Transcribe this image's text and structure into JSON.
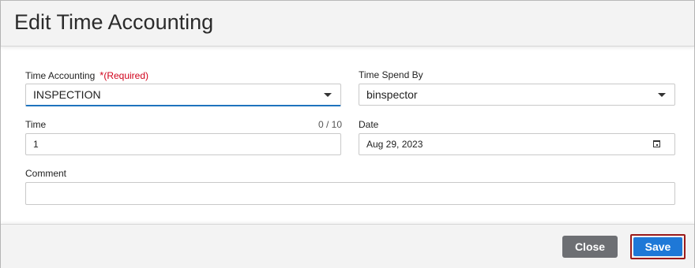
{
  "dialog": {
    "title": "Edit Time Accounting"
  },
  "form": {
    "time_accounting": {
      "label": "Time Accounting",
      "required_star": "*",
      "required_text": "(Required)",
      "value": "INSPECTION"
    },
    "time_spend_by": {
      "label": "Time Spend By",
      "value": "binspector"
    },
    "time": {
      "label": "Time",
      "counter": "0 / 10",
      "value": "1"
    },
    "date": {
      "label": "Date",
      "value": "Aug 29, 2023"
    },
    "comment": {
      "label": "Comment",
      "value": ""
    }
  },
  "footer": {
    "close_label": "Close",
    "save_label": "Save"
  },
  "colors": {
    "required": "#d0021b",
    "focus_accent": "#1e73be",
    "save_button": "#1e78d7",
    "close_button": "#6d6f73"
  }
}
